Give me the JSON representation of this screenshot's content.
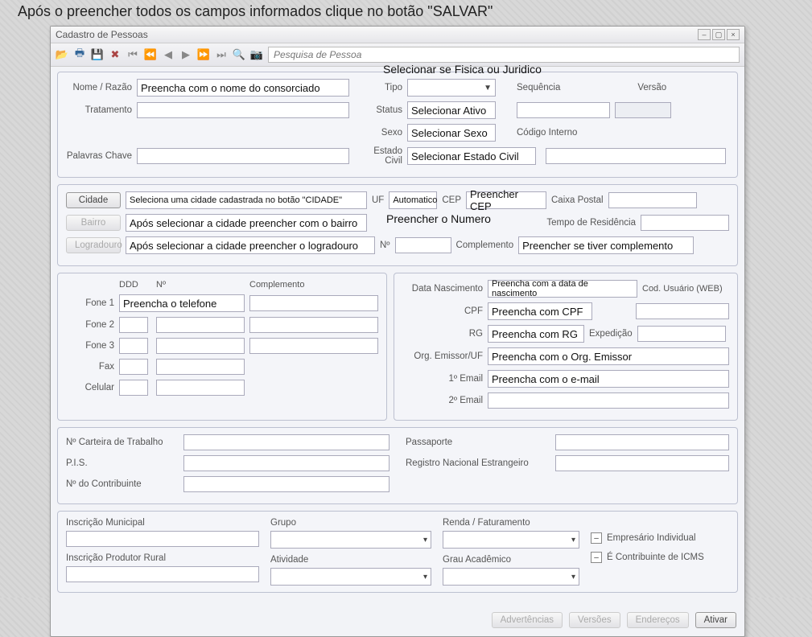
{
  "caption": "Após o preencher todos os campos informados clique no botão \"SALVAR\"",
  "window": {
    "title": "Cadastro de Pessoas"
  },
  "toolbar": {
    "search_placeholder": "Pesquisa de Pessoa"
  },
  "overlay": {
    "tipo_hint": "Selecionar se Fisica ou Juridico",
    "numero_hint": "Preencher o Numero"
  },
  "panel1": {
    "nome_lbl": "Nome / Razão",
    "nome_val": "Preencha com o nome do consorciado",
    "tratamento_lbl": "Tratamento",
    "palavras_lbl": "Palavras Chave",
    "tipo_lbl": "Tipo",
    "status_lbl": "Status",
    "status_val": "Selecionar Ativo",
    "sexo_lbl": "Sexo",
    "sexo_val": "Selecionar Sexo",
    "estcivil_lbl": "Estado Civil",
    "estcivil_val": "Selecionar Estado Civil",
    "seq_lbl": "Sequência",
    "versao_lbl": "Versão",
    "codint_lbl": "Código Interno"
  },
  "panel2": {
    "cidade_btn": "Cidade",
    "cidade_val": "Seleciona uma cidade cadastrada no botão \"CIDADE\"",
    "uf_lbl": "UF",
    "uf_val": "Automatico",
    "cep_lbl": "CEP",
    "cep_val": "Preencher CEP",
    "caixa_lbl": "Caixa Postal",
    "bairro_btn": "Bairro",
    "bairro_val": "Após selecionar a cidade preencher com o bairro",
    "tempo_lbl": "Tempo de Residência",
    "logra_btn": "Logradouro",
    "logra_val": "Após selecionar a cidade preencher o logradouro",
    "num_lbl": "Nº",
    "comp_lbl": "Complemento",
    "comp_val": "Preencher se tiver complemento"
  },
  "phones": {
    "ddd": "DDD",
    "num": "Nº",
    "compl": "Complemento",
    "fone1": "Fone 1",
    "fone1_val": "Preencha o telefone",
    "fone2": "Fone 2",
    "fone3": "Fone 3",
    "fax": "Fax",
    "cel": "Celular"
  },
  "docs": {
    "datanasc_lbl": "Data Nascimento",
    "datanasc_val": "Preencha com a data de nascimento",
    "codweb_lbl": "Cod. Usuário (WEB)",
    "cpf_lbl": "CPF",
    "cpf_val": "Preencha com CPF",
    "rg_lbl": "RG",
    "rg_val": "Preencha com RG",
    "exped_lbl": "Expedição",
    "org_lbl": "Org. Emissor/UF",
    "org_val": "Preencha com o Org. Emissor",
    "email1_lbl": "1º Email",
    "email1_val": "Preencha com o e-mail",
    "email2_lbl": "2º Email"
  },
  "panel4": {
    "cart_lbl": "Nº Carteira de Trabalho",
    "pis_lbl": "P.I.S.",
    "contr_lbl": "Nº do Contribuinte",
    "pass_lbl": "Passaporte",
    "rne_lbl": "Registro Nacional Estrangeiro"
  },
  "panel5": {
    "inscmun_lbl": "Inscrição Municipal",
    "grupo_lbl": "Grupo",
    "renda_lbl": "Renda / Faturamento",
    "inscrural_lbl": "Inscrição Produtor Rural",
    "ativ_lbl": "Atividade",
    "grau_lbl": "Grau Acadêmico",
    "chk1": "Empresário Individual",
    "chk2": "É Contribuinte de ICMS"
  },
  "footer": {
    "advert": "Advertências",
    "versoes": "Versões",
    "ender": "Endereços",
    "ativar": "Ativar"
  }
}
